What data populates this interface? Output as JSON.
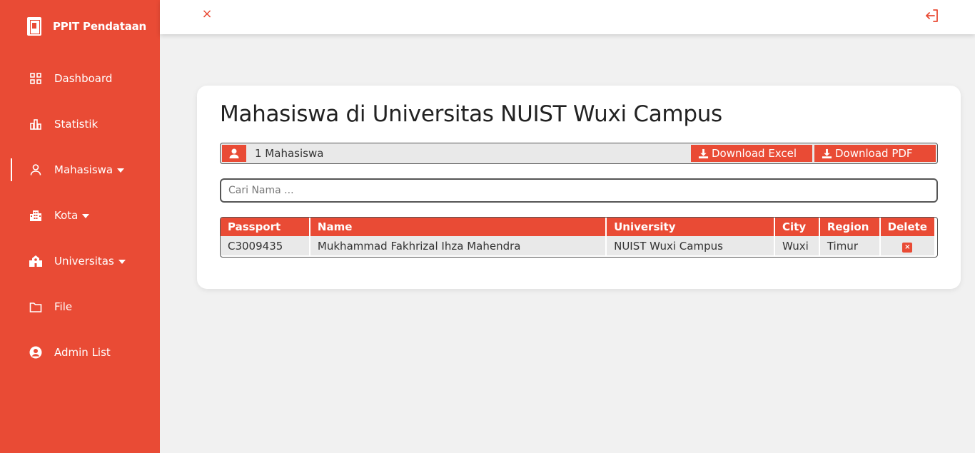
{
  "sidebar": {
    "brand": "PPIT Pendataan",
    "items": [
      {
        "label": "Dashboard",
        "icon": "grid-icon"
      },
      {
        "label": "Statistik",
        "icon": "bar-chart-icon"
      },
      {
        "label": "Mahasiswa",
        "icon": "user-icon",
        "dropdown": true,
        "active": true
      },
      {
        "label": "Kota",
        "icon": "building-icon",
        "dropdown": true
      },
      {
        "label": "Universitas",
        "icon": "school-icon",
        "dropdown": true
      },
      {
        "label": "File",
        "icon": "folder-icon"
      },
      {
        "label": "Admin List",
        "icon": "user-circle-icon"
      }
    ]
  },
  "topbar": {
    "close_icon": "×",
    "logout_icon": "logout-icon"
  },
  "main": {
    "title": "Mahasiswa di Universitas NUIST Wuxi Campus",
    "count_text": "1 Mahasiswa",
    "download_excel": "Download Excel",
    "download_pdf": "Download PDF",
    "search_placeholder": "Cari Nama ...",
    "table": {
      "headers": [
        "Passport",
        "Name",
        "University",
        "City",
        "Region",
        "Delete"
      ],
      "rows": [
        [
          "C3009435",
          "Mukhammad Fakhrizal Ihza Mahendra",
          "NUIST Wuxi Campus",
          "Wuxi",
          "Timur",
          "×"
        ]
      ]
    }
  },
  "colors": {
    "accent": "#e94b35",
    "background": "#f1f1f1"
  }
}
